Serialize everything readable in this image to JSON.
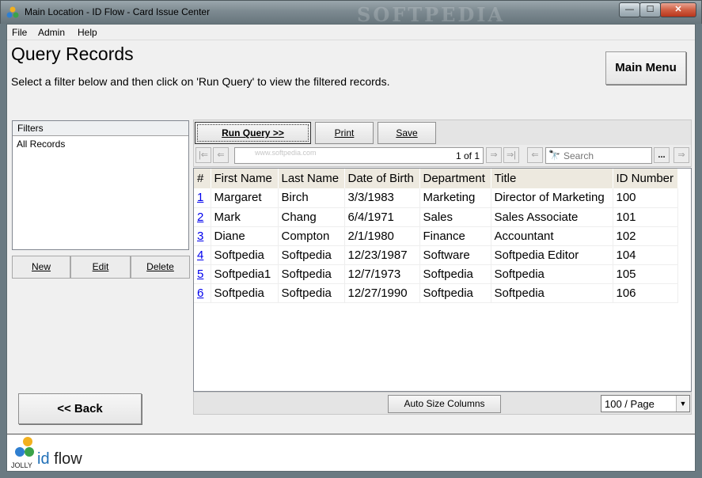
{
  "window": {
    "title": "Main Location - ID Flow - Card Issue Center",
    "watermark": "SOFTPEDIA",
    "controls": {
      "minimize": "—",
      "maximize": "☐",
      "close": "✕"
    }
  },
  "menu": [
    "File",
    "Admin",
    "Help"
  ],
  "page": {
    "title": "Query Records",
    "instructions": "Select a filter below and then click on 'Run Query' to view the filtered records.",
    "main_menu_label": "Main Menu",
    "back_label": "<< Back"
  },
  "filters": {
    "header": "Filters",
    "items": [
      "All Records"
    ],
    "buttons": {
      "new": "New",
      "edit": "Edit",
      "delete": "Delete"
    }
  },
  "query_toolbar": {
    "run_query": "Run Query >>",
    "print": "Print",
    "save": "Save"
  },
  "navigator": {
    "page_indicator": "1 of 1",
    "watermark": "www.softpedia.com",
    "search_placeholder": "Search",
    "more_label": "...",
    "icons": {
      "first": "first-page-icon",
      "prev": "previous-page-icon",
      "next": "next-page-icon",
      "last": "last-page-icon",
      "back": "back-arrow-icon",
      "search": "binoculars-icon",
      "forward": "forward-arrow-icon"
    }
  },
  "grid": {
    "columns": [
      "#",
      "First Name",
      "Last Name",
      "Date of Birth",
      "Department",
      "Title",
      "ID Number"
    ],
    "rows": [
      [
        "1",
        "Margaret",
        "Birch",
        "3/3/1983",
        "Marketing",
        "Director of Marketing",
        "100"
      ],
      [
        "2",
        "Mark",
        "Chang",
        "6/4/1971",
        "Sales",
        "Sales Associate",
        "101"
      ],
      [
        "3",
        "Diane",
        "Compton",
        "2/1/1980",
        "Finance",
        "Accountant",
        "102"
      ],
      [
        "4",
        "Softpedia",
        "Softpedia",
        "12/23/1987",
        "Software",
        "Softpedia Editor",
        "104"
      ],
      [
        "5",
        "Softpedia1",
        "Softpedia",
        "12/7/1973",
        "Softpedia",
        "Softpedia",
        "105"
      ],
      [
        "6",
        "Softpedia",
        "Softpedia",
        "12/27/1990",
        "Softpedia",
        "Softpedia",
        "106"
      ]
    ],
    "auto_size_label": "Auto Size Columns",
    "page_size": "100 / Page"
  },
  "footer": {
    "logo_text": "JOLLY",
    "brand_id": "id",
    "brand_flow": " flow"
  }
}
